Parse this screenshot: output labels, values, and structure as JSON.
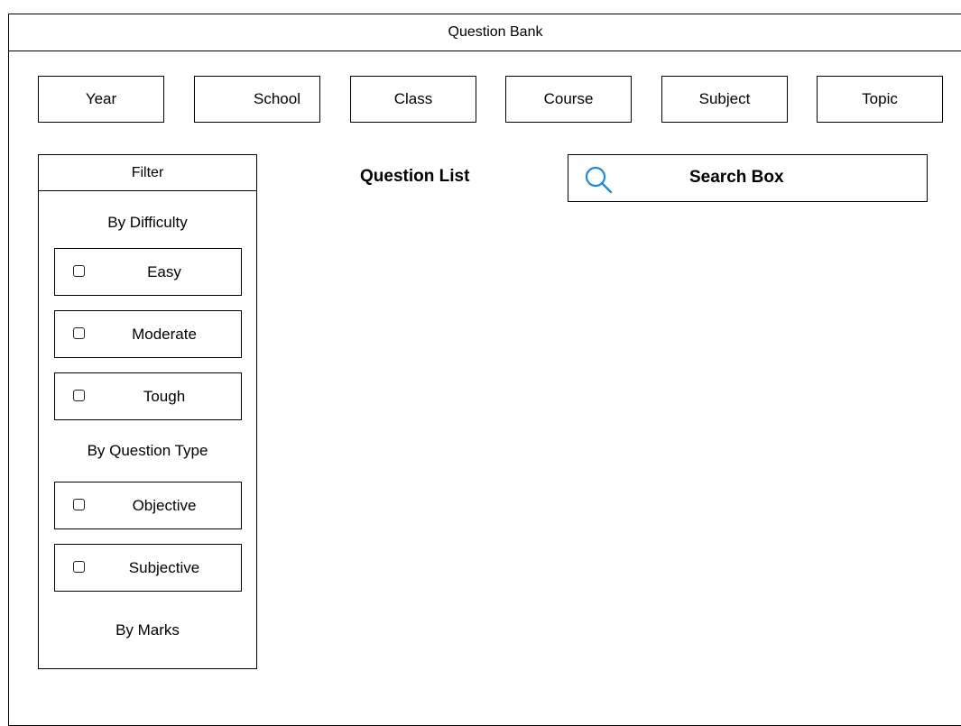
{
  "window": {
    "title": "Question Bank"
  },
  "categories": [
    {
      "label": "Year"
    },
    {
      "label": "School"
    },
    {
      "label": "Class"
    },
    {
      "label": "Course"
    },
    {
      "label": "Subject"
    },
    {
      "label": "Topic"
    }
  ],
  "filter": {
    "title": "Filter",
    "difficulty": {
      "label": "By Difficulty",
      "options": [
        {
          "label": "Easy",
          "checked": false
        },
        {
          "label": "Moderate",
          "checked": false
        },
        {
          "label": "Tough",
          "checked": false
        }
      ]
    },
    "question_type": {
      "label": "By Question Type",
      "options": [
        {
          "label": "Objective",
          "checked": false
        },
        {
          "label": "Subjective",
          "checked": false
        }
      ]
    },
    "marks": {
      "label": "By Marks"
    }
  },
  "main": {
    "list_title": "Question List",
    "search": {
      "label": "Search Box",
      "icon": "search-icon",
      "icon_color": "#1E88E5"
    }
  }
}
